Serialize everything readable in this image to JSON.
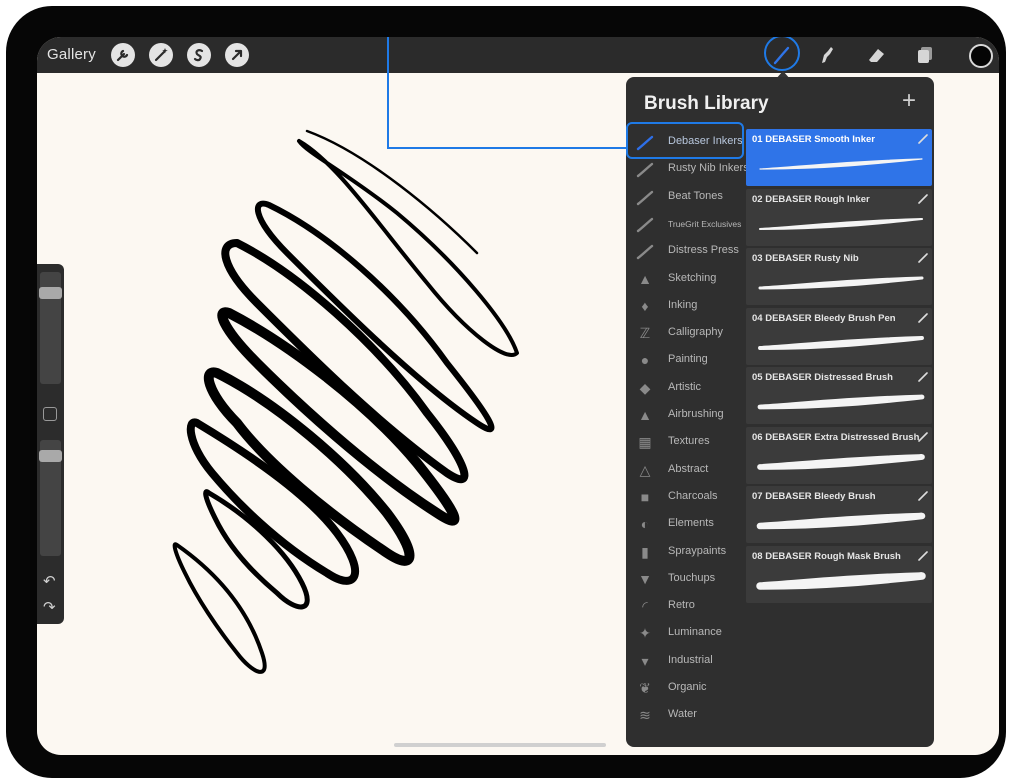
{
  "toolbar": {
    "gallery_label": "Gallery",
    "left_tools": [
      "wrench-icon",
      "magic-wand-icon",
      "selection-s-icon",
      "transform-arrow-icon"
    ],
    "right_tools": [
      "brush-icon",
      "smudge-icon",
      "eraser-icon",
      "layers-icon"
    ],
    "active_tool": "brush-icon",
    "current_color": "#050505",
    "accent_color": "#1f7ae6"
  },
  "sidebar": {
    "brush_size": 0.85,
    "opacity": 0.9,
    "icons": [
      "modify-square-icon",
      "undo-icon",
      "redo-icon"
    ]
  },
  "brush_library": {
    "title": "Brush Library",
    "add_label": "+",
    "categories": [
      {
        "label": "Debaser Inkers",
        "icon": "brush-stroke-icon",
        "selected": true
      },
      {
        "label": "Rusty Nib Inkers",
        "icon": "brush-stroke-icon"
      },
      {
        "label": "Beat Tones",
        "icon": "brush-stroke-icon"
      },
      {
        "label": "TrueGrit Exclusives",
        "icon": "brush-stroke-icon"
      },
      {
        "label": "Distress Press",
        "icon": "brush-stroke-icon"
      },
      {
        "label": "Sketching",
        "icon": "pencil-tip-icon"
      },
      {
        "label": "Inking",
        "icon": "ink-drop-icon"
      },
      {
        "label": "Calligraphy",
        "icon": "calligraphy-icon"
      },
      {
        "label": "Painting",
        "icon": "paint-drop-icon"
      },
      {
        "label": "Artistic",
        "icon": "artistic-icon"
      },
      {
        "label": "Airbrushing",
        "icon": "airbrush-icon"
      },
      {
        "label": "Textures",
        "icon": "texture-icon"
      },
      {
        "label": "Abstract",
        "icon": "triangle-icon"
      },
      {
        "label": "Charcoals",
        "icon": "charcoal-icon"
      },
      {
        "label": "Elements",
        "icon": "globe-icon"
      },
      {
        "label": "Spraypaints",
        "icon": "spraycan-icon"
      },
      {
        "label": "Touchups",
        "icon": "touchup-icon"
      },
      {
        "label": "Retro",
        "icon": "retro-icon"
      },
      {
        "label": "Luminance",
        "icon": "sparkle-icon"
      },
      {
        "label": "Industrial",
        "icon": "anvil-icon"
      },
      {
        "label": "Organic",
        "icon": "leaf-icon"
      },
      {
        "label": "Water",
        "icon": "waves-icon"
      }
    ],
    "brushes": [
      {
        "name": "01 DEBASER Smooth Inker",
        "selected": true
      },
      {
        "name": "02 DEBASER Rough Inker"
      },
      {
        "name": "03 DEBASER Rusty Nib"
      },
      {
        "name": "04 DEBASER Bleedy Brush Pen"
      },
      {
        "name": "05 DEBASER Distressed Brush"
      },
      {
        "name": "06 DEBASER Extra Distressed Brush"
      },
      {
        "name": "07 DEBASER Bleedy Brush"
      },
      {
        "name": "08 DEBASER Rough Mask Brush"
      }
    ]
  }
}
